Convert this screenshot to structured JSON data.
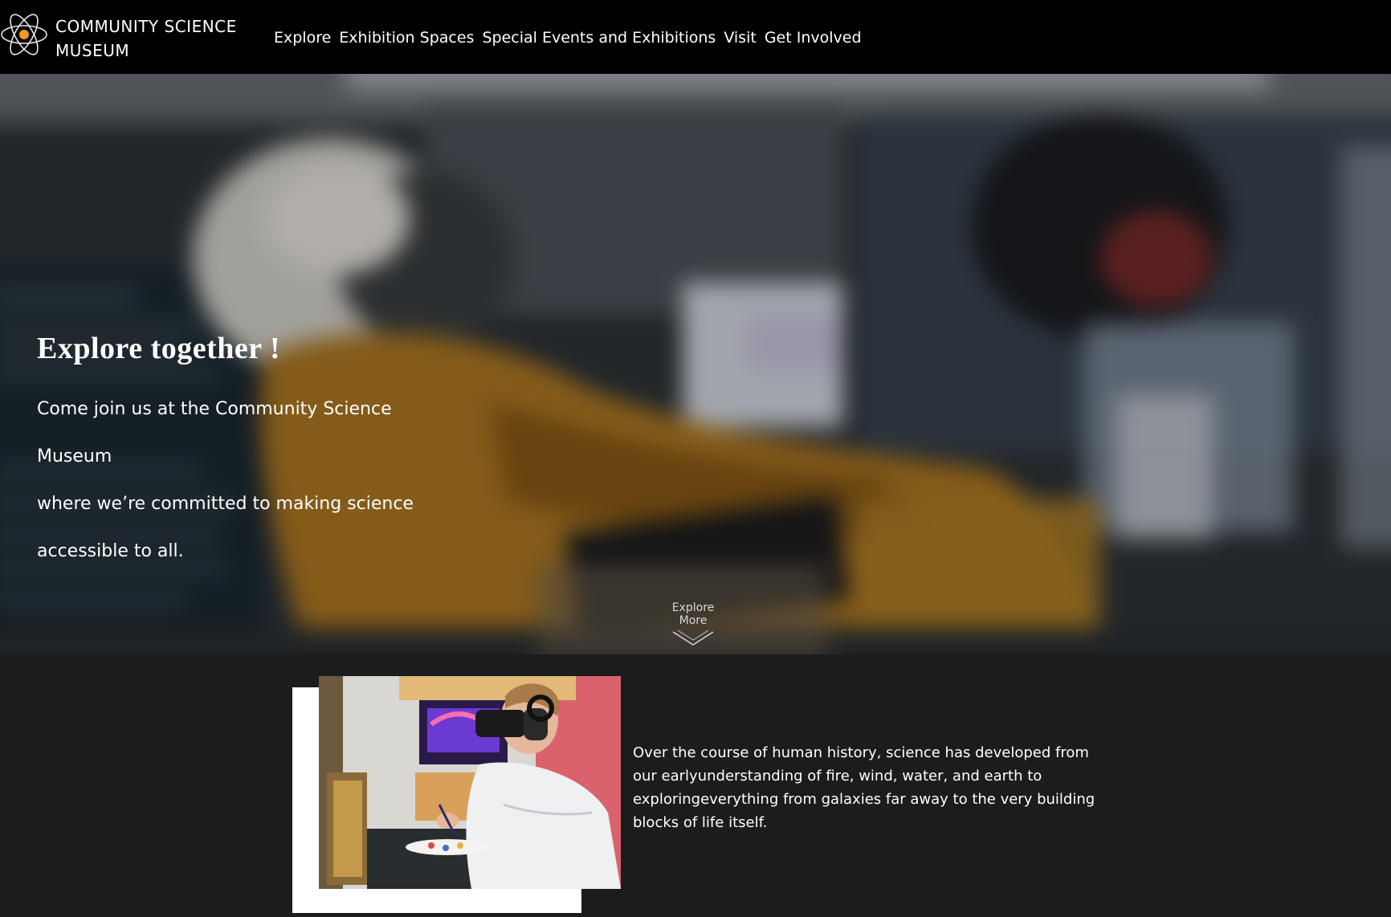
{
  "header": {
    "brand_line1": "COMMUNITY SCIENCE",
    "brand_line2": "MUSEUM",
    "logo_icon": "atom-icon",
    "nav": [
      {
        "label": "Explore"
      },
      {
        "label": "Exhibition Spaces"
      },
      {
        "label": "Special Events and Exhibitions"
      },
      {
        "label": "Visit"
      },
      {
        "label": "Get Involved"
      }
    ]
  },
  "hero": {
    "title": "Explore together !",
    "text_line1": "Come join us at the Community Science Museum",
    "text_line2": "where we’re committed to making science",
    "text_line3": "accessible to all.",
    "explore_more": "Explore More",
    "background": "astronaut-suit-photo"
  },
  "about": {
    "photo": "vr-headset-painter-photo",
    "text": "Over the course of human history, science has developed from our earlyunderstanding of fire, wind, water, and earth to exploringeverything from galaxies far away to the very building blocks of life itself."
  },
  "colors": {
    "header_bg": "#000000",
    "page_bg": "#1c1c1c",
    "accent_orange": "#f39a1e"
  }
}
